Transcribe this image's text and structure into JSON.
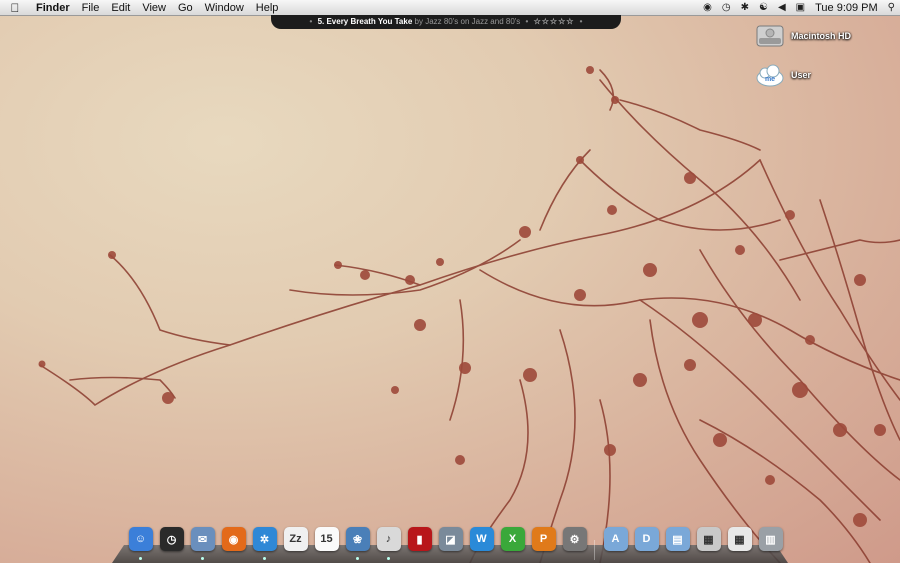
{
  "menubar": {
    "apple_icon": "apple-logo-icon",
    "items": [
      "Finder",
      "File",
      "Edit",
      "View",
      "Go",
      "Window",
      "Help"
    ],
    "status": {
      "clock": "Tue 9:09 PM",
      "icons": [
        "script-icon",
        "time-machine-icon",
        "bluetooth-icon",
        "wifi-icon",
        "volume-icon",
        "battery-icon",
        "spotlight-icon"
      ]
    }
  },
  "now_playing": {
    "track": "5. Every Breath You Take",
    "by": "by Jazz 80's on Jazz and 80's",
    "stars": "☆☆☆☆☆"
  },
  "desktop_icons": [
    {
      "label": "Macintosh HD",
      "icon": "hard-drive-icon"
    },
    {
      "label": "User",
      "icon": "mobileme-cloud-icon"
    }
  ],
  "dock": {
    "apps": [
      {
        "name": "finder",
        "glyph": "☺",
        "color": "#3b7fd9",
        "running": true
      },
      {
        "name": "dashboard",
        "glyph": "◷",
        "color": "#2a2a2a",
        "running": false
      },
      {
        "name": "mail",
        "glyph": "✉",
        "color": "#6a8fbd",
        "running": true
      },
      {
        "name": "firefox",
        "glyph": "◉",
        "color": "#e36a1a",
        "running": false
      },
      {
        "name": "safari",
        "glyph": "✲",
        "color": "#2f88d6",
        "running": true
      },
      {
        "name": "adium",
        "glyph": "Zz",
        "color": "#f0f0f0",
        "running": false
      },
      {
        "name": "ical",
        "glyph": "15",
        "color": "#fafafa",
        "running": false
      },
      {
        "name": "iphoto",
        "glyph": "❀",
        "color": "#4a7fb8",
        "running": true
      },
      {
        "name": "itunes",
        "glyph": "♪",
        "color": "#d9d9d9",
        "running": true
      },
      {
        "name": "photo-booth",
        "glyph": "▮",
        "color": "#b8161a",
        "running": false
      },
      {
        "name": "preview",
        "glyph": "◪",
        "color": "#7a8a9a",
        "running": false
      },
      {
        "name": "word",
        "glyph": "W",
        "color": "#2a8ad8",
        "running": false
      },
      {
        "name": "excel",
        "glyph": "X",
        "color": "#3aa83a",
        "running": false
      },
      {
        "name": "powerpoint",
        "glyph": "P",
        "color": "#e07a1a",
        "running": false
      },
      {
        "name": "system-preferences",
        "glyph": "⚙",
        "color": "#777",
        "running": false
      }
    ],
    "folders": [
      {
        "name": "applications-folder",
        "glyph": "A",
        "color": "#7aa8d8"
      },
      {
        "name": "documents-folder",
        "glyph": "D",
        "color": "#7aa8d8"
      },
      {
        "name": "downloads-folder",
        "glyph": "▤",
        "color": "#7aa8d8"
      },
      {
        "name": "downloads-stack",
        "glyph": "▦",
        "color": "#c9c9c9"
      },
      {
        "name": "screenshots-stack",
        "glyph": "▦",
        "color": "#e8e8e8"
      },
      {
        "name": "trash",
        "glyph": "▥",
        "color": "#9aa0a6"
      }
    ]
  }
}
